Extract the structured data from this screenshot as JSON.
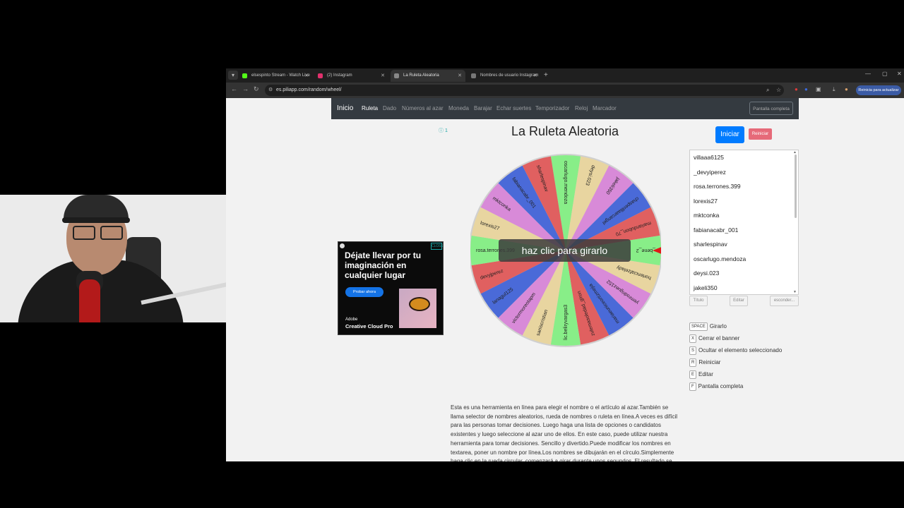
{
  "browser": {
    "tabs": [
      {
        "label": "elsespinto Stream - Watch Live",
        "favicon_color": "#53fc18",
        "active": false
      },
      {
        "label": "(2) Instagram",
        "favicon_color": "#e1306c",
        "active": false
      },
      {
        "label": "La Ruleta Aleatoria",
        "favicon_color": "#888888",
        "active": true
      },
      {
        "label": "Nombres de usuario Instagram",
        "favicon_color": "#777777",
        "active": false
      }
    ],
    "url": "es.piliapp.com/random/wheel/",
    "reload_label": "Reinicia para actualizar"
  },
  "navbar": {
    "brand": "Inicio",
    "links": [
      "Ruleta",
      "Dado",
      "Números al azar",
      "Moneda",
      "Barajar",
      "Echar suertes",
      "Temporizador",
      "Reloj",
      "Marcador"
    ],
    "fullscreen": "Pantalla completa"
  },
  "page": {
    "title": "La Ruleta Aleatoria",
    "info_badge": "ⓘ 1",
    "start_button": "Iniciar",
    "reset_button": "Reiniciar",
    "wheel_center_label": "haz clic para girarlo"
  },
  "wheel": {
    "colors": [
      "#88ee88",
      "#e8d5a0",
      "#d88ad8",
      "#4a6ad8",
      "#e06060"
    ],
    "labels": [
      "oscarlugo.mendoza",
      "deysi.023",
      "jakeli350",
      "chasperilliaarcangel",
      "mariandubon_70",
      "_bene_2",
      "hortenciafzelady",
      "yemrodriguez152",
      "mariaeuniceortizmejia",
      "zulemasoledad_giron",
      "lic.beliryvargas3",
      "saniscristian",
      "victormoreotapm",
      "lanagul125",
      "devyjperez",
      "rosa.terrones.399",
      "lorexis27",
      "mktconka",
      "fabianacabr_001",
      "sharlespinav"
    ]
  },
  "ad": {
    "headline": "Déjate llevar por tu imaginación en cualquier lugar",
    "button": "Probar ahora",
    "brand_line1": "Adobe",
    "brand_line2": "Creative Cloud Pro",
    "close": "CLOSE"
  },
  "names_list": [
    "villaaa6125",
    "_devyiperez",
    "rosa.terrones.399",
    "lorexis27",
    "mktconka",
    "fabianacabr_001",
    "sharlespinav",
    "oscarlugo.mendoza",
    "deysi.023",
    "jakeli350"
  ],
  "list_buttons": [
    "Título",
    "Editar",
    "esconder..."
  ],
  "shortcuts": [
    {
      "key": "SPACE",
      "label": "Girarlo"
    },
    {
      "key": "X",
      "label": "Cerrar el banner"
    },
    {
      "key": "S",
      "label": "Ocultar el elemento seleccionado"
    },
    {
      "key": "R",
      "label": "Reiniciar"
    },
    {
      "key": "E",
      "label": "Editar"
    },
    {
      "key": "F",
      "label": "Pantalla completa"
    }
  ],
  "description": "Esta es una herramienta en línea para elegir el nombre o el artículo al azar.También se llama selector de nombres aleatorios, rueda de nombres o ruleta en línea.A veces es difícil para las personas tomar decisiones. Luego haga una lista de opciones o candidatos existentes y luego seleccione al azar uno de ellos. En este caso, puede utilizar nuestra herramienta para tomar decisiones. Sencillo y divertido.Puede modificar los nombres en textarea, poner un nombre por línea.Los nombres se dibujarán en el círculo.Simplemente haga clic en la rueda circular, comenzará a girar durante unos segundos. El resultado se seleccionará al azar una"
}
